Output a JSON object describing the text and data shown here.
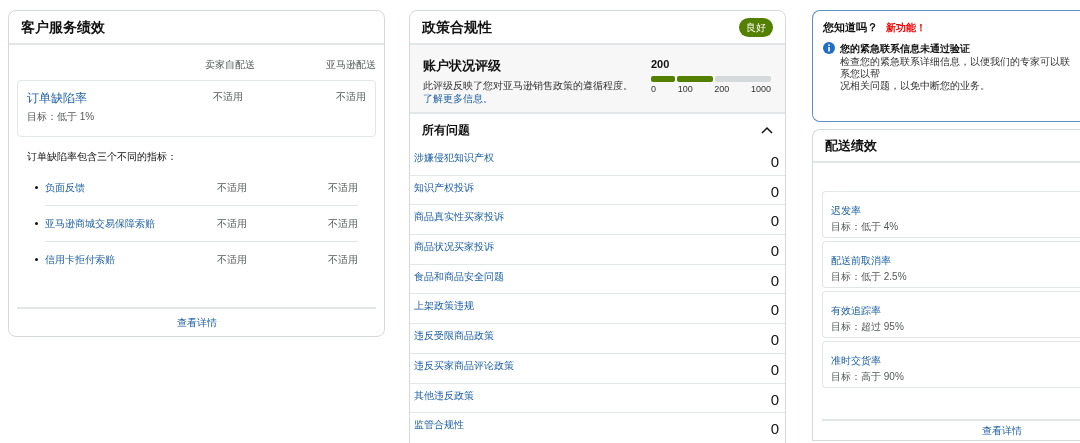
{
  "customer_service": {
    "title": "客户服务绩效",
    "columns": [
      "卖家自配送",
      "亚马逊配送"
    ],
    "main_metric": {
      "name": "订单缺陷率",
      "target": "目标：低于 1%",
      "values": [
        "不适用",
        "不适用"
      ]
    },
    "intro": "订单缺陷率包含三个不同的指标：",
    "sub_metrics": [
      {
        "name": "负面反馈",
        "values": [
          "不适用",
          "不适用"
        ]
      },
      {
        "name": "亚马逊商城交易保障索赔",
        "values": [
          "不适用",
          "不适用"
        ]
      },
      {
        "name": "信用卡拒付索赔",
        "values": [
          "不适用",
          "不适用"
        ]
      }
    ],
    "footer_link": "查看详情"
  },
  "policy": {
    "title": "政策合规性",
    "badge": "良好",
    "rating": {
      "title": "账户状况评级",
      "description": "此评级反映了您对亚马逊销售政策的遵循程度。",
      "link": "了解更多信息。",
      "score": "200",
      "segments": [
        {
          "filled": true
        },
        {
          "filled": true
        },
        {
          "filled": false
        }
      ],
      "ticks": [
        "0",
        "100",
        "200",
        "1000"
      ]
    },
    "issues_title": "所有问题",
    "expanded": true,
    "issues": [
      {
        "name": "涉嫌侵犯知识产权",
        "count": "0"
      },
      {
        "name": "知识产权投诉",
        "count": "0"
      },
      {
        "name": "商品真实性买家投诉",
        "count": "0"
      },
      {
        "name": "商品状况买家投诉",
        "count": "0"
      },
      {
        "name": "食品和商品安全问题",
        "count": "0"
      },
      {
        "name": "上架政策违规",
        "count": "0"
      },
      {
        "name": "违反受限商品政策",
        "count": "0"
      },
      {
        "name": "违反买家商品评论政策",
        "count": "0"
      },
      {
        "name": "其他违反政策",
        "count": "0"
      },
      {
        "name": "监管合规性",
        "count": "0"
      }
    ]
  },
  "notice": {
    "title": "您知道吗？",
    "tag": "新功能！",
    "heading": "您的紧急联系信息未通过验证",
    "lines": [
      "检查您的紧急联系详细信息，以便我们的专家可以联系您以帮",
      "况相关问题，以免中断您的业务。"
    ]
  },
  "shipping": {
    "title": "配送绩效",
    "metrics": [
      {
        "name": "迟发率",
        "target": "目标：低于 4%"
      },
      {
        "name": "配送前取消率",
        "target": "目标：低于 2.5%"
      },
      {
        "name": "有效追踪率",
        "target": "目标：超过 95%"
      },
      {
        "name": "准时交货率",
        "target": "目标：高于 90%"
      }
    ],
    "footer_link": "查看详情"
  }
}
